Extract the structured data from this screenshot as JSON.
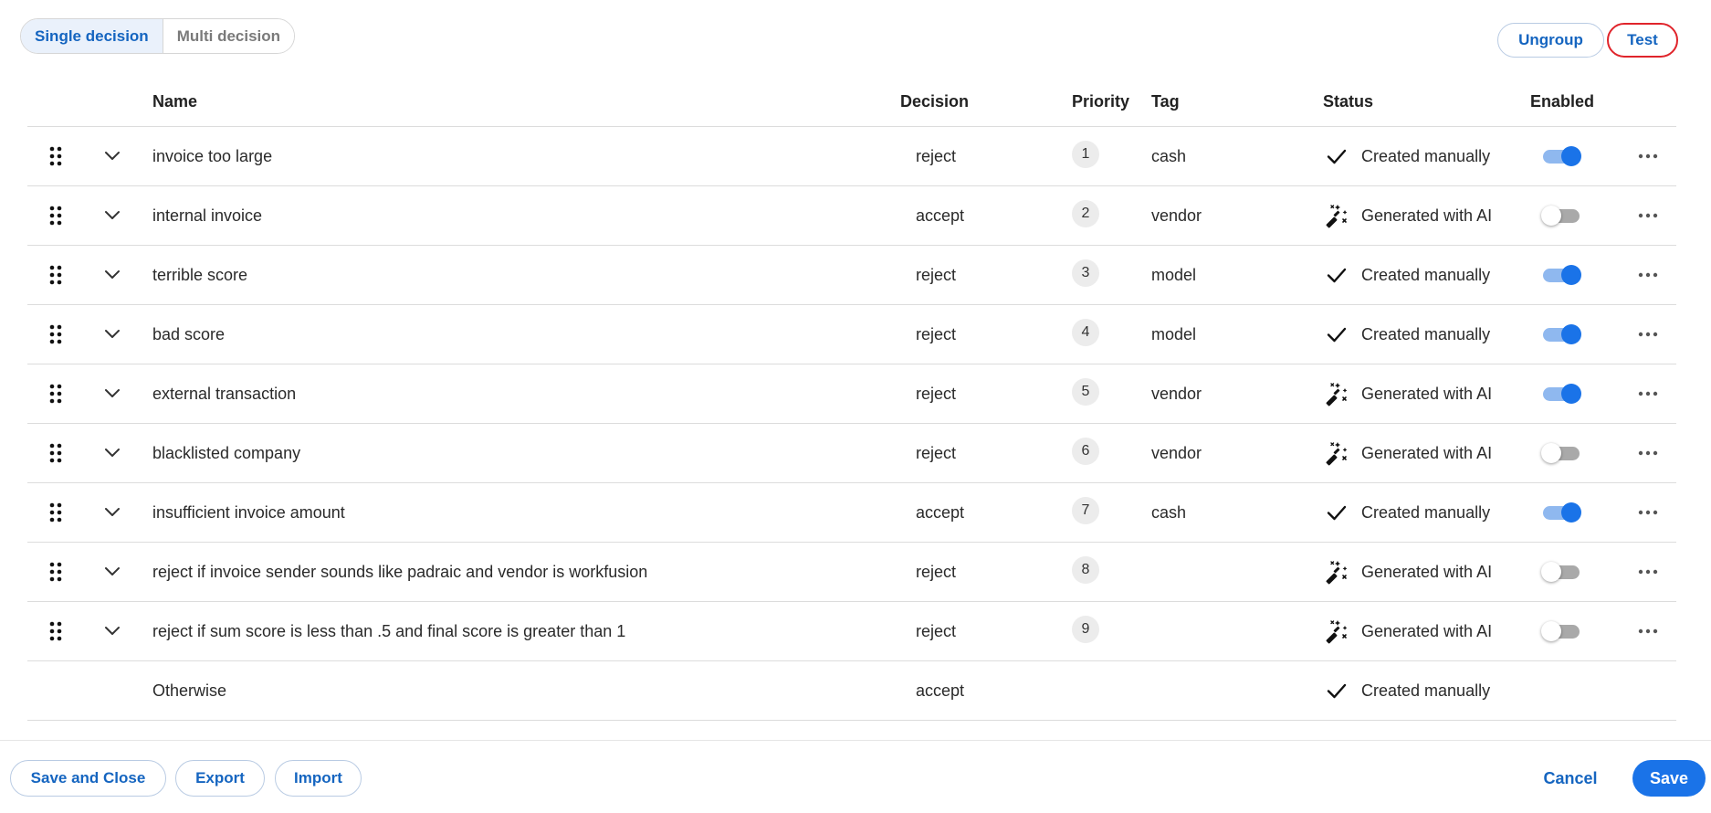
{
  "mode_tabs": {
    "single": "Single decision",
    "multi": "Multi decision"
  },
  "top_actions": {
    "ungroup": "Ungroup",
    "test": "Test"
  },
  "columns": {
    "name": "Name",
    "decision": "Decision",
    "priority": "Priority",
    "tag": "Tag",
    "status": "Status",
    "enabled": "Enabled"
  },
  "rows": [
    {
      "name": "invoice too large",
      "decision": "reject",
      "priority": "1",
      "tag": "cash",
      "status": "Created manually",
      "status_icon": "check-icon",
      "enabled": true
    },
    {
      "name": "internal invoice",
      "decision": "accept",
      "priority": "2",
      "tag": "vendor",
      "status": "Generated with AI",
      "status_icon": "magic-wand-icon",
      "enabled": false
    },
    {
      "name": "terrible score",
      "decision": "reject",
      "priority": "3",
      "tag": "model",
      "status": "Created manually",
      "status_icon": "check-icon",
      "enabled": true
    },
    {
      "name": "bad score",
      "decision": "reject",
      "priority": "4",
      "tag": "model",
      "status": "Created manually",
      "status_icon": "check-icon",
      "enabled": true
    },
    {
      "name": "external transaction",
      "decision": "reject",
      "priority": "5",
      "tag": "vendor",
      "status": "Generated with AI",
      "status_icon": "magic-wand-icon",
      "enabled": true
    },
    {
      "name": "blacklisted company",
      "decision": "reject",
      "priority": "6",
      "tag": "vendor",
      "status": "Generated with AI",
      "status_icon": "magic-wand-icon",
      "enabled": false
    },
    {
      "name": "insufficient invoice amount",
      "decision": "accept",
      "priority": "7",
      "tag": "cash",
      "status": "Created manually",
      "status_icon": "check-icon",
      "enabled": true
    },
    {
      "name": "reject if invoice sender sounds like padraic and vendor is workfusion",
      "decision": "reject",
      "priority": "8",
      "tag": "",
      "status": "Generated with AI",
      "status_icon": "magic-wand-icon",
      "enabled": false
    },
    {
      "name": "reject if sum score is less than .5 and final score is greater than 1",
      "decision": "reject",
      "priority": "9",
      "tag": "",
      "status": "Generated with AI",
      "status_icon": "magic-wand-icon",
      "enabled": false
    }
  ],
  "otherwise_row": {
    "name": "Otherwise",
    "decision": "accept",
    "status": "Created manually",
    "status_icon": "check-icon"
  },
  "footer": {
    "save_and_close": "Save and Close",
    "export": "Export",
    "import": "Import",
    "cancel": "Cancel",
    "save": "Save"
  },
  "colors": {
    "accent": "#1a73e8",
    "test_outline": "#e0242b"
  }
}
